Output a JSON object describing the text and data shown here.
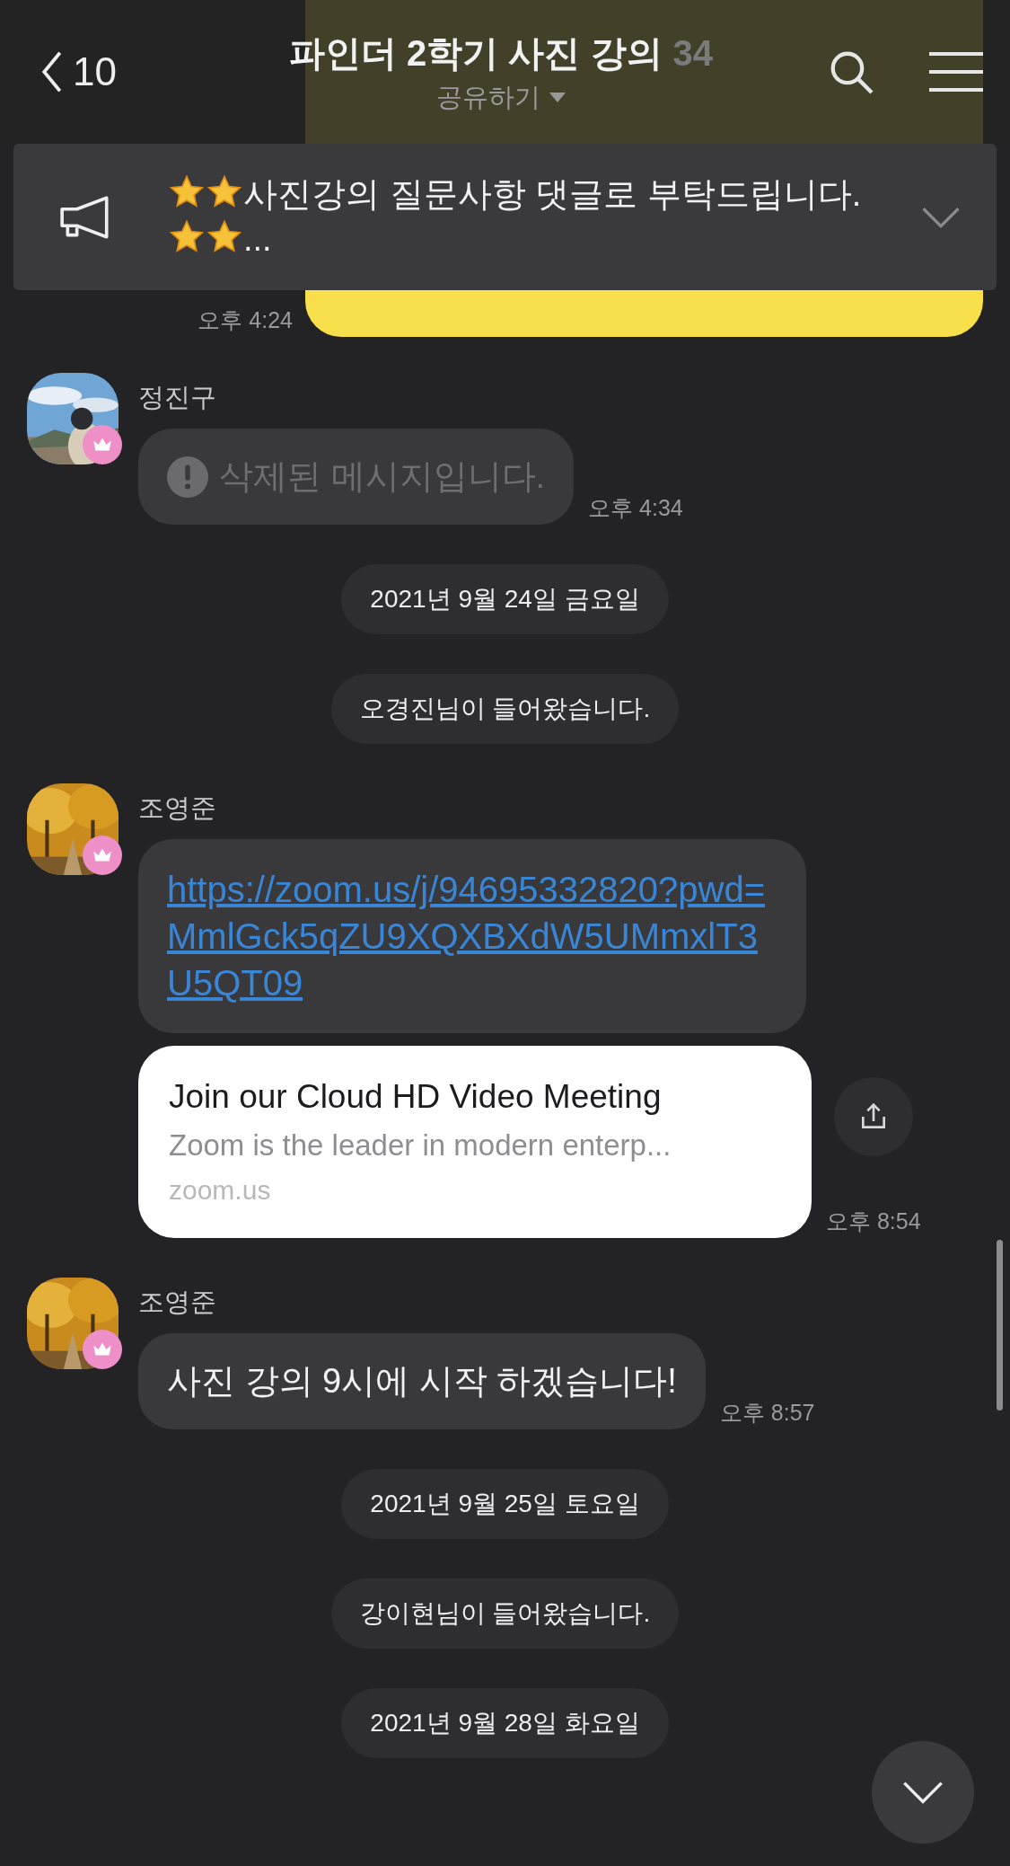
{
  "header": {
    "back_count": "10",
    "title": "파인더 2학기 사진 강의",
    "member_count": "34",
    "subtitle": "공유하기"
  },
  "notice": {
    "parts": [
      {
        "kind": "star"
      },
      {
        "kind": "star"
      },
      {
        "kind": "text",
        "text": "사진강의 질문사항 댓글로 부탁드립니다."
      },
      {
        "kind": "star"
      },
      {
        "kind": "star"
      },
      {
        "kind": "text",
        "text": "..."
      }
    ]
  },
  "messages": [
    {
      "kind": "own",
      "time": "오후 4:24"
    },
    {
      "kind": "deleted",
      "sender": "정진구",
      "text": "삭제된 메시지입니다.",
      "time": "오후 4:34"
    },
    {
      "kind": "date",
      "text": "2021년 9월 24일 금요일"
    },
    {
      "kind": "system",
      "text": "오경진님이 들어왔습니다."
    },
    {
      "kind": "link",
      "sender": "조영준",
      "url": "https://zoom.us/j/94695332820?pwd=MmlGck5qZU9XQXBXdW5UMmxlT3U5QT09",
      "preview": {
        "title": "Join our Cloud HD Video Meeting",
        "description": "Zoom is the leader in modern enterp...",
        "domain": "zoom.us"
      },
      "time": "오후 8:54"
    },
    {
      "kind": "text",
      "sender": "조영준",
      "text": "사진 강의 9시에 시작 하겠습니다!",
      "time": "오후 8:57"
    },
    {
      "kind": "date",
      "text": "2021년 9월 25일 토요일"
    },
    {
      "kind": "system",
      "text": "강이현님이 들어왔습니다."
    },
    {
      "kind": "date",
      "text": "2021년 9월 28일 화요일"
    }
  ]
}
